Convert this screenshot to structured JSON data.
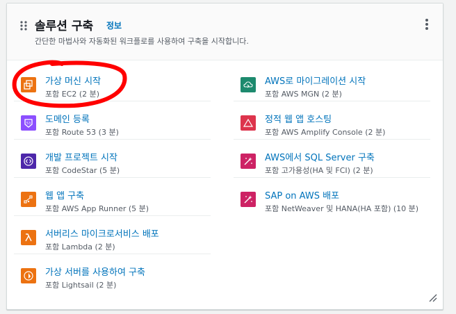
{
  "widget": {
    "title": "솔루션 구축",
    "info_label": "정보",
    "subtitle": "간단한 마법사와 자동화된 워크플로를 사용하여 구축을 시작합니다."
  },
  "left_items": [
    {
      "label": "가상 머신 시작",
      "meta": "포함 EC2 (2 분)",
      "icon": "ec2-icon",
      "color": "#ec7211"
    },
    {
      "label": "도메인 등록",
      "meta": "포함 Route 53 (3 분)",
      "icon": "route53-icon",
      "color": "#8c4fff"
    },
    {
      "label": "개발 프로젝트 시작",
      "meta": "포함 CodeStar (5 분)",
      "icon": "codestar-icon",
      "color": "#4d27aa"
    },
    {
      "label": "웹 앱 구축",
      "meta": "포함 AWS App Runner (5 분)",
      "icon": "app-runner-icon",
      "color": "#ec7211"
    },
    {
      "label": "서버리스 마이크로서비스 배포",
      "meta": "포함 Lambda (2 분)",
      "icon": "lambda-icon",
      "color": "#ec7211"
    },
    {
      "label": "가상 서버를 사용하여 구축",
      "meta": "포함 Lightsail (2 분)",
      "icon": "lightsail-icon",
      "color": "#ec7211"
    }
  ],
  "right_items": [
    {
      "label": "AWS로 마이그레이션 시작",
      "meta": "포함 AWS MGN (2 분)",
      "icon": "mgn-icon",
      "color": "#1d8a6e"
    },
    {
      "label": "정적 웹 앱 호스팅",
      "meta": "포함 AWS Amplify Console (2 분)",
      "icon": "amplify-icon",
      "color": "#dd344c"
    },
    {
      "label": "AWS에서 SQL Server 구축",
      "meta": "포함 고가용성(HA 및 FCI) (2 분)",
      "icon": "sql-server-icon",
      "color": "#cd2264"
    },
    {
      "label": "SAP on AWS 배포",
      "meta": "포함 NetWeaver 및 HANA(HA 포함) (10 분)",
      "icon": "sap-icon",
      "color": "#cd2264"
    }
  ],
  "annotation_color": "#ff0000"
}
